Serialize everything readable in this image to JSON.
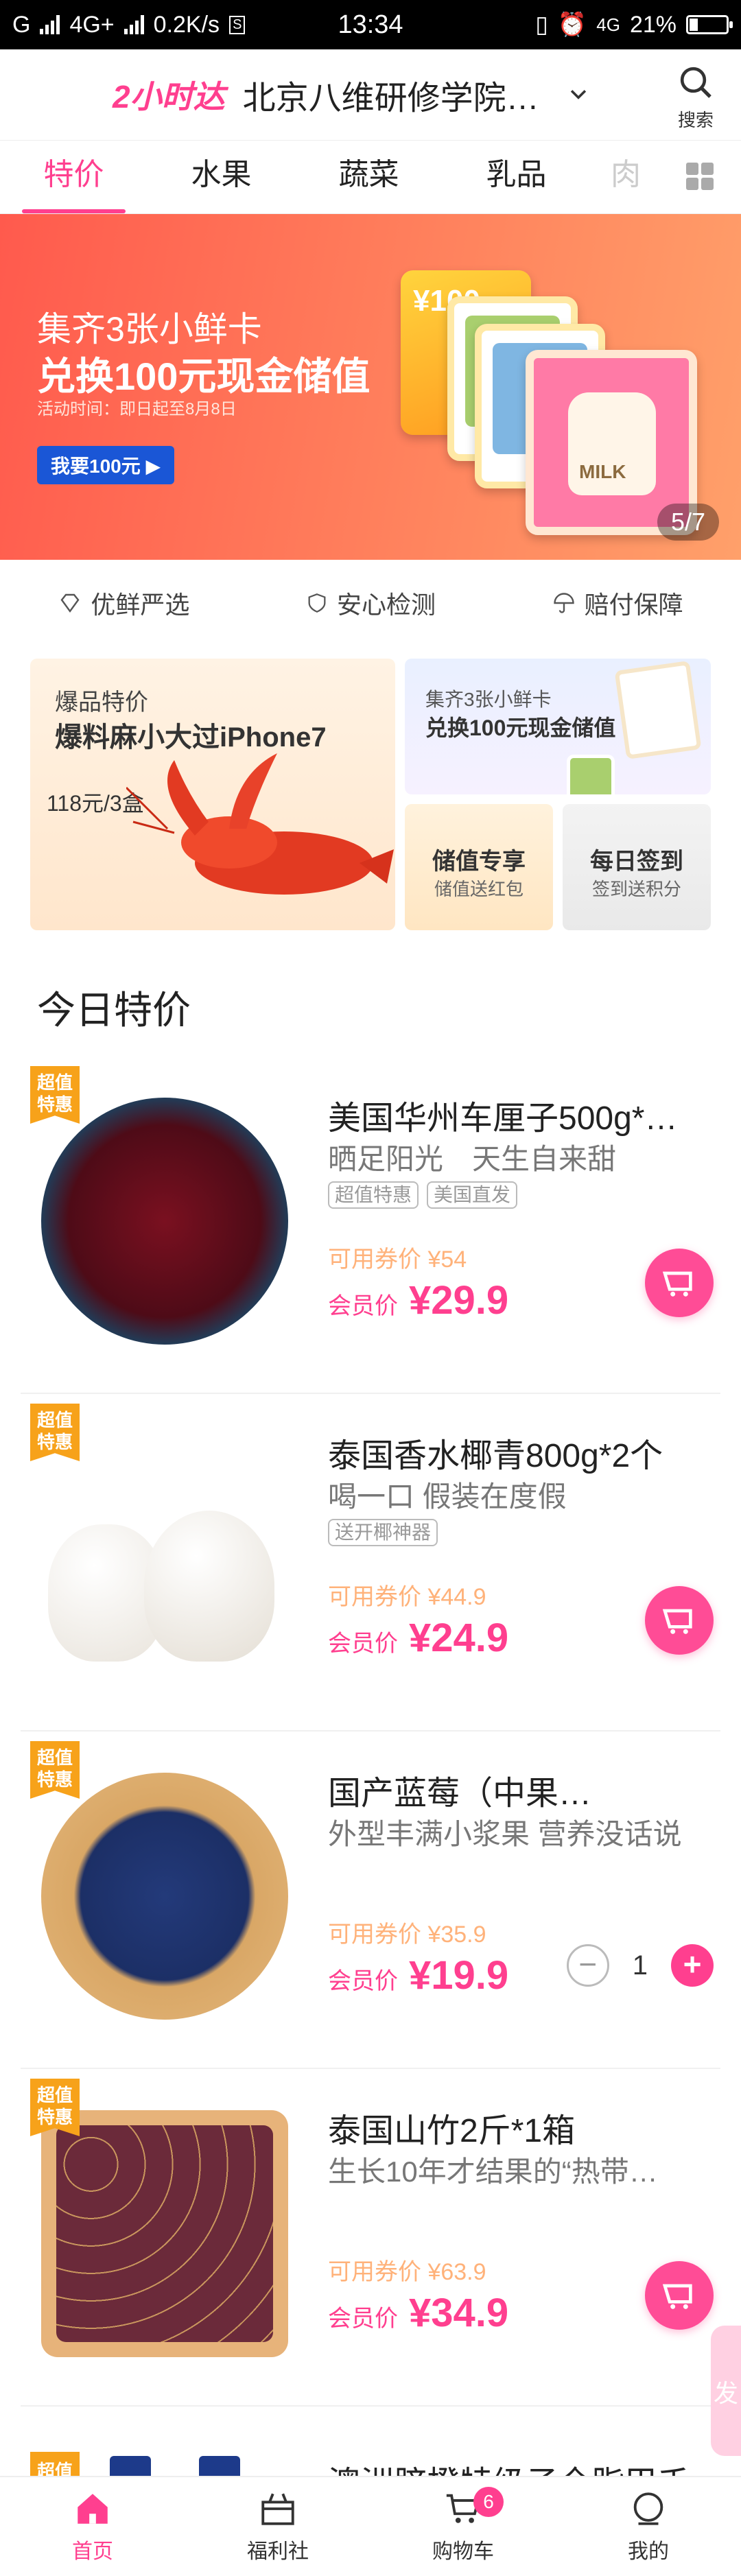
{
  "status_bar": {
    "carrier_left": "G",
    "network_1": "4G+",
    "speed": "0.2K/s",
    "time": "13:34",
    "network_2": "4G",
    "battery": "21%"
  },
  "header": {
    "delivery_badge": "2小时达",
    "location": "北京八维研修学院…",
    "search_label": "搜索"
  },
  "tabs": [
    {
      "label": "特价",
      "active": true
    },
    {
      "label": "水果",
      "active": false
    },
    {
      "label": "蔬菜",
      "active": false
    },
    {
      "label": "乳品",
      "active": false
    },
    {
      "label": "肉",
      "active": false
    }
  ],
  "banner": {
    "line1": "集齐3张小鲜卡",
    "line2": "兑换100元现金储值",
    "line3": "活动时间：即日起至8月8日",
    "cta": "我要100元",
    "card_value": "¥100",
    "card_milk": "MILK",
    "pager": "5/7"
  },
  "features": [
    {
      "label": "优鲜严选",
      "icon": "diamond-icon"
    },
    {
      "label": "安心检测",
      "icon": "shield-icon"
    },
    {
      "label": "赔付保障",
      "icon": "umbrella-icon"
    }
  ],
  "promos": {
    "big": {
      "subtitle": "爆品特价",
      "title": "爆料麻小大过iPhone7",
      "price": "118元/3盒"
    },
    "wide": {
      "line1": "集齐3张小鲜卡",
      "line2": "兑换100元现金储值"
    },
    "small1": {
      "title": "储值专享",
      "subtitle": "储值送红包"
    },
    "small2": {
      "title": "每日签到",
      "subtitle": "签到送积分"
    }
  },
  "section_title": "今日特价",
  "products": [
    {
      "tag": "超值特惠",
      "name": "美国华州车厘子500g*…",
      "desc": "晒足阳光　天生自来甜",
      "pills": [
        "超值特惠",
        "美国直发"
      ],
      "coupon_price": "可用券价 ¥54",
      "member_label": "会员价",
      "member_price": "¥29.9",
      "action": "cart"
    },
    {
      "tag": "超值特惠",
      "name": "泰国香水椰青800g*2个",
      "desc": "喝一口 假装在度假",
      "pills": [
        "送开椰神器"
      ],
      "coupon_price": "可用券价 ¥44.9",
      "member_label": "会员价",
      "member_price": "¥24.9",
      "action": "cart"
    },
    {
      "tag": "超值特惠",
      "name": "国产蓝莓（中果…",
      "desc": "外型丰满小浆果 营养没话说",
      "pills": [],
      "coupon_price": "可用券价 ¥35.9",
      "member_label": "会员价",
      "member_price": "¥19.9",
      "action": "stepper",
      "quantity": "1"
    },
    {
      "tag": "超值特惠",
      "name": "泰国山竹2斤*1箱",
      "desc": "生长10年才结果的“热带…",
      "pills": [],
      "coupon_price": "可用券价 ¥63.9",
      "member_label": "会员价",
      "member_price": "¥34.9",
      "action": "cart"
    }
  ],
  "partial_item": {
    "tag": "超值",
    "name": "澳洲脐橙特级子全脂甲禾"
  },
  "side_float": "发",
  "bottom_nav": [
    {
      "label": "首页",
      "icon": "home-icon",
      "active": true
    },
    {
      "label": "福利社",
      "icon": "gift-icon",
      "active": false
    },
    {
      "label": "购物车",
      "icon": "cart-icon",
      "active": false,
      "badge": "6"
    },
    {
      "label": "我的",
      "icon": "profile-icon",
      "active": false
    }
  ],
  "colors": {
    "accent": "#ff3f8f",
    "tag_orange": "#f7a21a",
    "coupon": "#ffb27a",
    "banner": "#ff6b55"
  }
}
